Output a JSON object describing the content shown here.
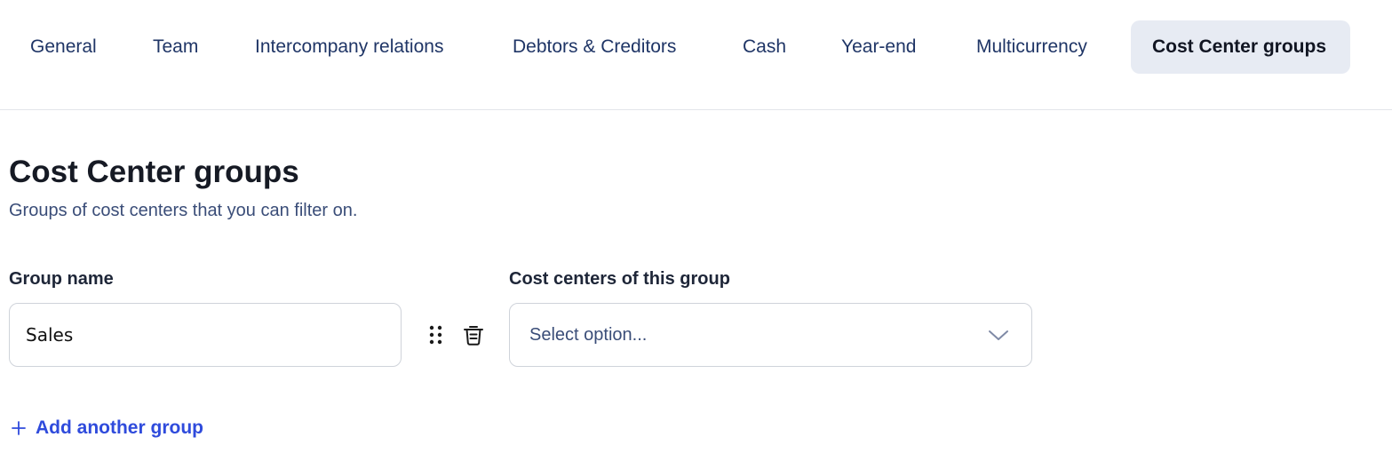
{
  "tabs": [
    {
      "label": "General",
      "active": false
    },
    {
      "label": "Team",
      "active": false
    },
    {
      "label": "Intercompany relations",
      "active": false
    },
    {
      "label": "Debtors & Creditors",
      "active": false
    },
    {
      "label": "Cash",
      "active": false
    },
    {
      "label": "Year-end",
      "active": false
    },
    {
      "label": "Multicurrency",
      "active": false
    },
    {
      "label": "Cost Center groups",
      "active": true
    }
  ],
  "page": {
    "title": "Cost Center groups",
    "subtitle": "Groups of cost centers that you can filter on."
  },
  "form": {
    "group_name_label": "Group name",
    "cost_centers_label": "Cost centers of this group",
    "groups": [
      {
        "name": "Sales",
        "cost_centers_placeholder": "Select option..."
      }
    ],
    "add_group_label": "Add another group"
  },
  "icons": {
    "drag": "drag-handle-icon",
    "delete": "trash-icon",
    "dropdown": "chevron-down-icon",
    "add": "plus-icon"
  },
  "colors": {
    "tab_text": "#1f3566",
    "tab_active_bg": "#e7ebf3",
    "link": "#2f4bdc",
    "subtitle": "#3a4d78"
  }
}
